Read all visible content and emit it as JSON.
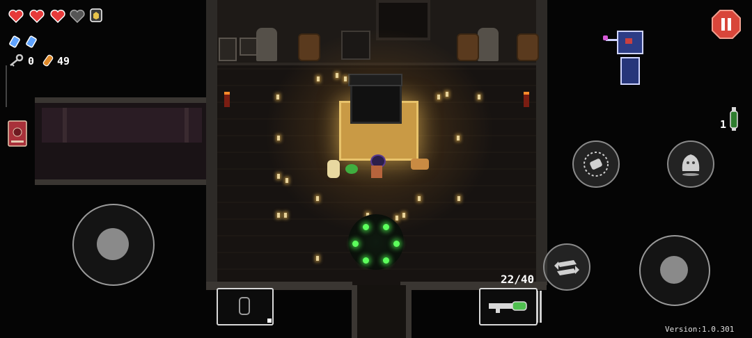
{
  "hud": {
    "health": {
      "full_hearts": 3,
      "empty_hearts": 1,
      "armor": 1
    },
    "blanks": 2,
    "keys": "0",
    "shells": "49",
    "ammo": "22/40",
    "item_count": "1",
    "version": "Version:1.0.301"
  },
  "icons": {
    "heart": "heart-icon",
    "armor": "armor-icon",
    "blank": "blank-icon",
    "key": "key-icon",
    "shell": "shell-currency-icon",
    "pause": "pause-icon",
    "dodge": "dodge-roll-icon",
    "use_item": "use-item-icon",
    "swap": "swap-weapon-icon",
    "interact": "interact-ghost-icon",
    "book": "ammonomicon-book-icon",
    "flask": "flask-item-icon"
  },
  "colors": {
    "heart_red": "#e63a3a",
    "pause_red": "#d8463a",
    "portal_green": "#5cff5c",
    "minimap_room": "#2d3d86",
    "altar_gold": "#c99a45"
  }
}
